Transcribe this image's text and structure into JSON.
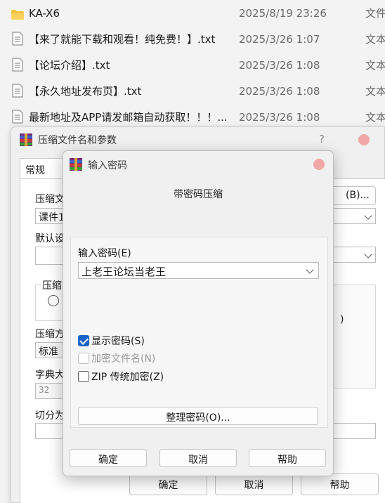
{
  "files": [
    {
      "name": "KA-X6",
      "date": "2025/8/19 23:26",
      "type": "文件",
      "icon": "folder-icon"
    },
    {
      "name": "【来了就能下载和观看！纯免费！】.txt",
      "date": "2025/3/26 1:07",
      "type": "文本",
      "icon": "text-file-icon"
    },
    {
      "name": "【论坛介绍】.txt",
      "date": "2025/3/26 1:08",
      "type": "文本",
      "icon": "text-file-icon"
    },
    {
      "name": "【永久地址发布页】.txt",
      "date": "2025/3/26 1:08",
      "type": "文本",
      "icon": "text-file-icon"
    },
    {
      "name": "最新地址及APP请发邮箱自动获取！！！...",
      "date": "2025/3/26 1:08",
      "type": "文本",
      "icon": "text-file-icon"
    }
  ],
  "parent_dialog": {
    "title": "压缩文件名和参数",
    "help_glyph": "?",
    "tab_general": "常规",
    "archive_name_label": "压缩文",
    "archive_name_value": "课件1",
    "browse_button": "(B)...",
    "default_profile_label": "默认设",
    "compress_group_label": "压缩",
    "compress_method_label": "压缩方",
    "compress_method_value": "标准",
    "dict_size_label": "字典大",
    "dict_size_value": "32",
    "split_label": "切分为",
    "right_paren": ")",
    "ok_button": "确定",
    "cancel_button": "取消",
    "help_button": "帮助"
  },
  "password_dialog": {
    "title": "输入密码",
    "subtitle": "带密码压缩",
    "enter_password_label": "输入密码(E)",
    "password_value": "上老王论坛当老王",
    "show_password_label": "显示密码(S)",
    "show_password_checked": true,
    "encrypt_names_label": "加密文件名(N)",
    "encrypt_names_checked": false,
    "zip_legacy_label": "ZIP 传统加密(Z)",
    "zip_legacy_checked": false,
    "organize_button": "整理密码(O)...",
    "ok_button": "确定",
    "cancel_button": "取消",
    "help_button": "帮助"
  }
}
